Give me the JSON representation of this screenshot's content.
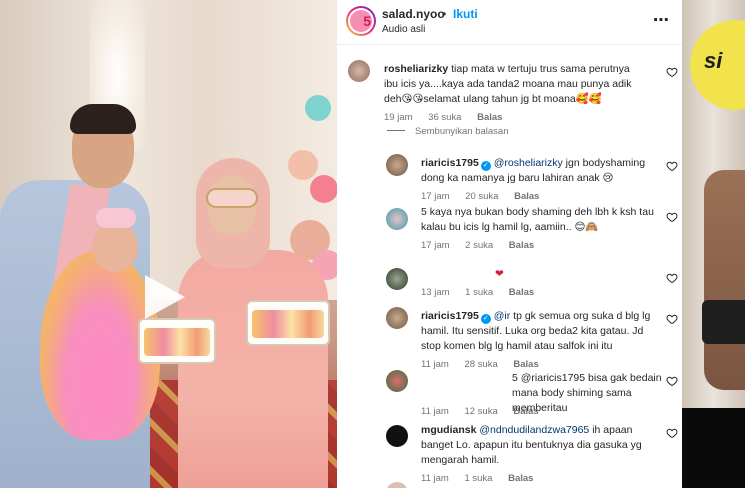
{
  "header": {
    "avatar_badge": "5",
    "username": "salad.nyoo",
    "dot": "•",
    "follow_label": "Ikuti",
    "audio": "Audio asli",
    "more_label": "⋯"
  },
  "comments": [
    {
      "user": "rosheliarizky",
      "text": "tiap mata w tertuju trus sama perutnya ibu icis ya....kaya ada tanda2 moana mau punya adik deh😘😘selamat ulang tahun jg bt moana🥰🥰",
      "time": "19 jam",
      "likes": "36 suka",
      "reply": "Balas"
    }
  ],
  "hide_replies": "Sembunyikan balasan",
  "replies": [
    {
      "user": "riaricis1795",
      "verified": "✓",
      "mention": "@rosheliarizky",
      "text": " jgn bodyshaming dong ka namanya jg baru lahiran anak 😢",
      "time": "17 jam",
      "likes": "20 suka",
      "reply": "Balas"
    },
    {
      "user": "",
      "mention": "",
      "text": "5 kaya nya bukan body shaming deh lbh k ksh tau kalau bu icis lg hamil lg, aamiin.. 😊🙈",
      "time": "17 jam",
      "likes": "2 suka",
      "reply": "Balas"
    },
    {
      "user": "",
      "mention": "",
      "text": "❤",
      "time": "13 jam",
      "likes": "1 suka",
      "reply": "Balas"
    },
    {
      "user": "riaricis1795",
      "verified": "✓",
      "mention": "@ir",
      "text": " tp gk semua org suka d blg lg hamil. Itu sensitif. Luka org beda2 kita gatau. Jd stop komen blg lg hamil atau salfok ini itu",
      "time": "11 jam",
      "likes": "28 suka",
      "reply": "Balas"
    },
    {
      "user": "",
      "mention": "@riaricis1795",
      "text": "5 @riaricis1795 bisa gak bedain mana body shiming sama memberitau",
      "time": "11 jam",
      "likes": "12 suka",
      "reply": "Balas"
    },
    {
      "user": "mgudiansk",
      "mention": "@ndndudilandzwa7965",
      "text": " ih apaan banget Lo. apapun itu bentuknya dia gasuka yg mengarah hamil.",
      "time": "11 jam",
      "likes": "1 suka",
      "reply": "Balas"
    }
  ],
  "strip": {
    "sign_text": "si"
  },
  "colors": {
    "link_blue": "#0095f6",
    "mention_blue": "#00376b",
    "muted": "#737373"
  }
}
